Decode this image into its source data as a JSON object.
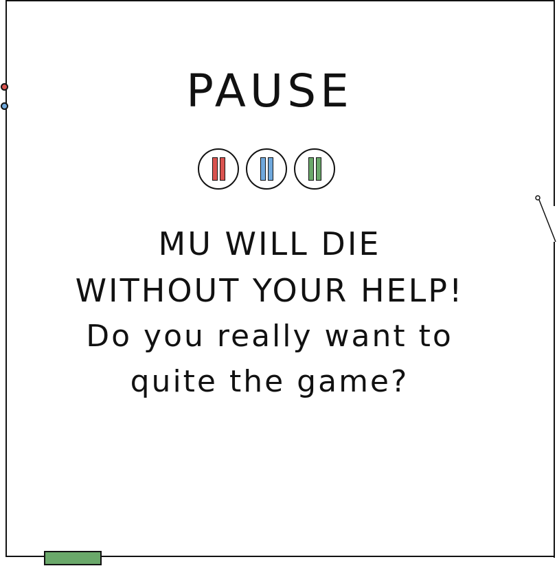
{
  "title": "PAUSE",
  "pause_buttons": [
    {
      "color": "#d9534f",
      "icon": "pause-icon"
    },
    {
      "color": "#6fa8dc",
      "icon": "pause-icon"
    },
    {
      "color": "#6aa86a",
      "icon": "pause-icon"
    }
  ],
  "warning": {
    "line1": "MU WILL DIE",
    "line2": "WITHOUT YOUR HELP!"
  },
  "question": {
    "line1": "Do you really want to",
    "line2": "quite the game?"
  },
  "colors": {
    "red": "#d9534f",
    "blue": "#6fa8dc",
    "green": "#6aa86a",
    "stroke": "#111111"
  }
}
